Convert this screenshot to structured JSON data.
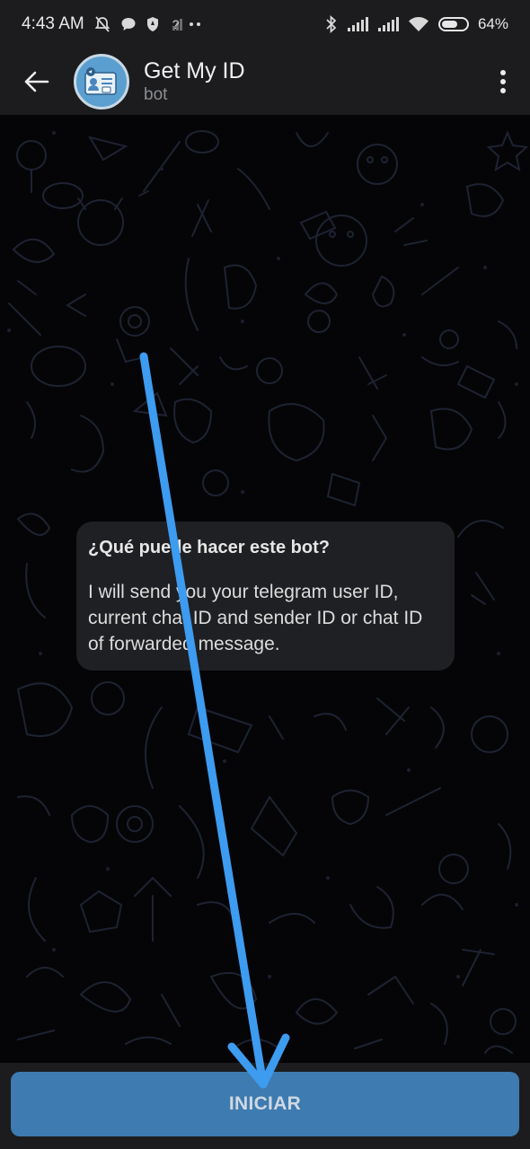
{
  "status_bar": {
    "time": "4:43 AM",
    "signal_text": "?",
    "battery_percent": "64%",
    "battery_level": 0.64,
    "icons": [
      "notifications-off-icon",
      "chat-bubble-icon",
      "shield-icon",
      "no-signal-icon",
      "more-dots-icon",
      "bluetooth-icon",
      "signal-icon",
      "signal-icon",
      "wifi-icon",
      "battery-icon"
    ]
  },
  "header": {
    "title": "Get My ID",
    "subtitle": "bot",
    "accent": "#5a9fd0"
  },
  "bot_info": {
    "title": "¿Qué puede hacer este bot?",
    "description": "I will send you your telegram user ID, current chat ID and sender ID or chat ID of forwarded message."
  },
  "bottom": {
    "start_label": "INICIAR",
    "button_color": "#3d7bb0"
  },
  "annotation": {
    "arrow_color": "#3d9bf0"
  }
}
